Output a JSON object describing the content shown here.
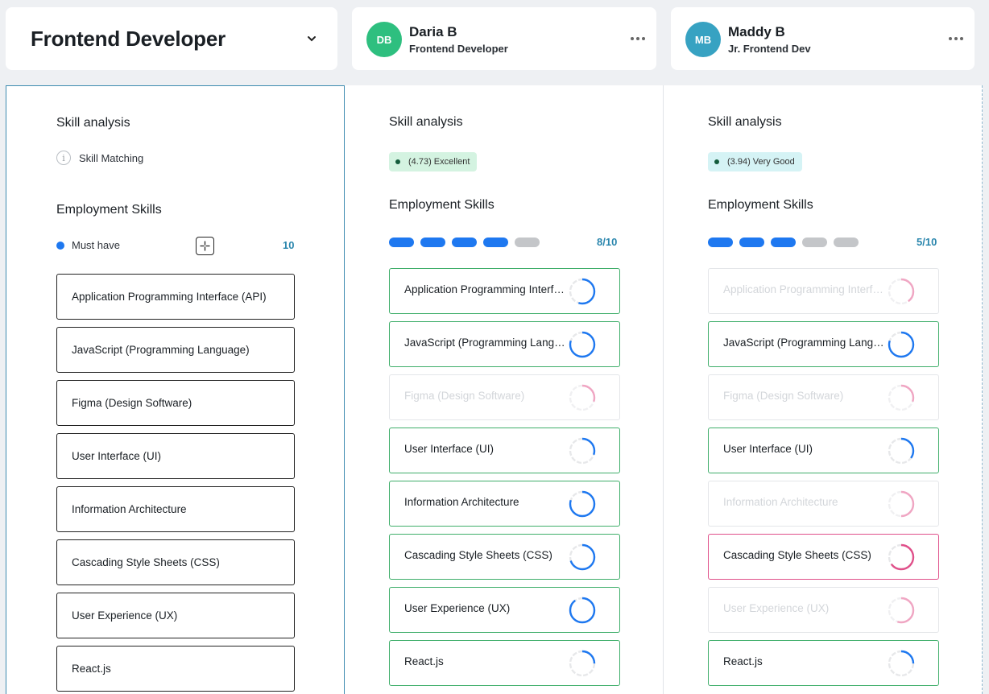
{
  "role": {
    "title": "Frontend Developer"
  },
  "candidates": [
    {
      "initials": "DB",
      "name": "Daria B",
      "role": "Frontend Developer",
      "avatar_color": "#2ebf7f",
      "rating": "(4.73) Excellent",
      "score": "8/10",
      "filled": 8
    },
    {
      "initials": "MB",
      "name": "Maddy B",
      "role": "Jr. Frontend Dev",
      "avatar_color": "#37a2c2",
      "rating": "(3.94) Very Good",
      "score": "5/10",
      "filled": 5
    }
  ],
  "labels": {
    "skill_analysis": "Skill analysis",
    "skill_matching": "Skill Matching",
    "employment_skills": "Employment Skills",
    "must_have": "Must have",
    "must_have_count": "10"
  },
  "skills": [
    "Application Programming Interface (API)",
    "JavaScript (Programming Language)",
    "Figma (Design Software)",
    "User Interface (UI)",
    "Information Architecture",
    "Cascading Style Sheets (CSS)",
    "User Experience (UX)",
    "React.js"
  ],
  "skill_status": {
    "daria": [
      "match",
      "match",
      "missing",
      "match",
      "match",
      "match",
      "match",
      "match"
    ],
    "maddy": [
      "missing",
      "match",
      "missing",
      "match",
      "missing",
      "weak",
      "missing",
      "match"
    ]
  },
  "skill_level": {
    "daria": [
      0.55,
      0.8,
      0.3,
      0.3,
      0.8,
      0.7,
      0.9,
      0.25
    ],
    "maddy": [
      0.4,
      0.8,
      0.3,
      0.35,
      0.5,
      0.65,
      0.55,
      0.25
    ]
  },
  "colors": {
    "accent": "#1e78f0",
    "match": "#3fae6a",
    "weak": "#e0508a",
    "faded_ring": "#f0a6c3",
    "count": "#2a86ad"
  }
}
